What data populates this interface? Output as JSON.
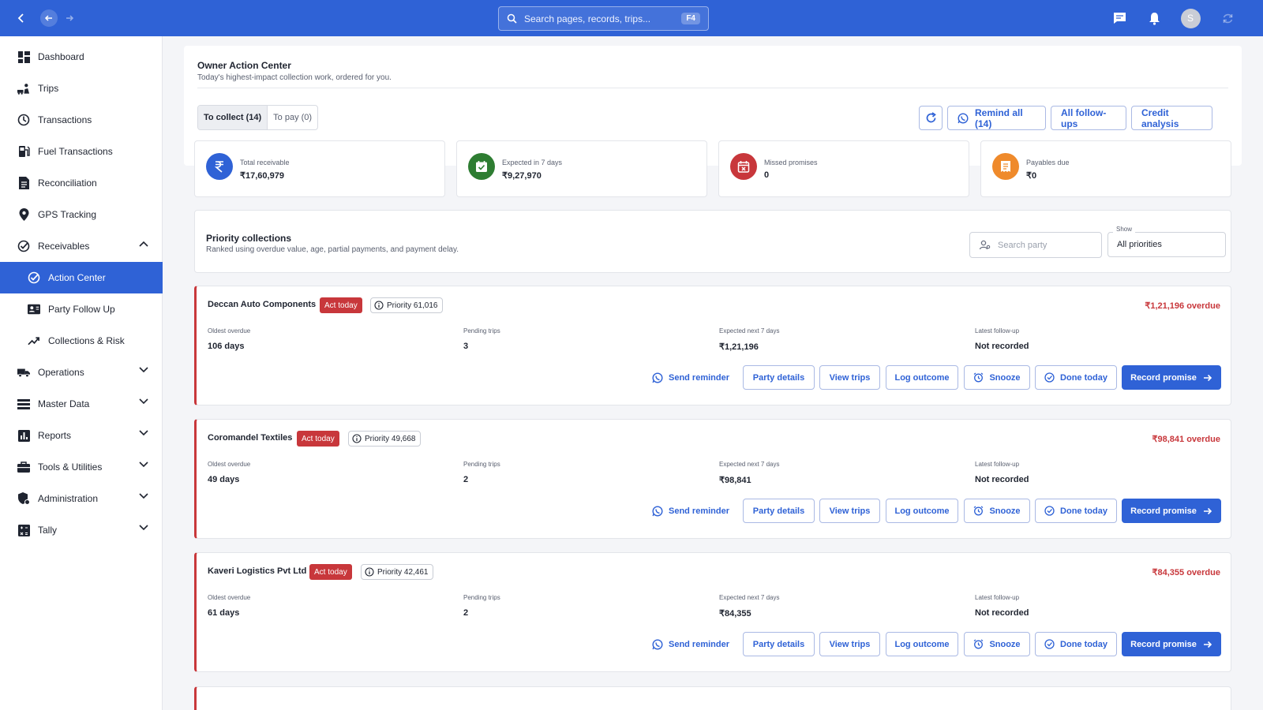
{
  "topbar": {
    "search_placeholder": "Search pages, records, trips...",
    "search_shortcut": "F4",
    "avatar_initial": "S",
    "icons": [
      "back-icon",
      "arrow-left-icon",
      "arrow-right-icon",
      "search-icon",
      "chat-icon",
      "bell-icon",
      "sync-icon"
    ]
  },
  "sidebar": {
    "items": [
      {
        "label": "Dashboard"
      },
      {
        "label": "Trips"
      },
      {
        "label": "Transactions"
      },
      {
        "label": "Fuel Transactions"
      },
      {
        "label": "Reconciliation"
      },
      {
        "label": "GPS Tracking"
      },
      {
        "label": "Receivables"
      },
      {
        "label": "Action Center"
      },
      {
        "label": "Party Follow Up"
      },
      {
        "label": "Collections & Risk"
      },
      {
        "label": "Operations"
      },
      {
        "label": "Master Data"
      },
      {
        "label": "Reports"
      },
      {
        "label": "Tools & Utilities"
      },
      {
        "label": "Administration"
      },
      {
        "label": "Tally"
      }
    ],
    "active_item": "Action Center"
  },
  "header": {
    "title": "Owner Action Center",
    "subtitle": "Today's highest-impact collection work, ordered for you.",
    "tabs": [
      {
        "label": "To collect (14)",
        "active": true
      },
      {
        "label": "To pay (0)",
        "active": false
      }
    ],
    "remind_all_label": "Remind all (14)",
    "all_followups_label": "All follow-ups",
    "credit_analysis_label": "Credit analysis"
  },
  "kpis": [
    {
      "label": "Total receivable",
      "value": "₹17,60,979",
      "color": "#2f62d6",
      "icon": "rupee-icon"
    },
    {
      "label": "Expected in 7 days",
      "value": "₹9,27,970",
      "color": "#2e7d32",
      "icon": "calendar-check-icon"
    },
    {
      "label": "Missed promises",
      "value": "0",
      "color": "#c8373b",
      "icon": "calendar-x-icon"
    },
    {
      "label": "Payables due",
      "value": "₹0",
      "color": "#ef8a2b",
      "icon": "receipt-icon"
    }
  ],
  "priority": {
    "title": "Priority collections",
    "subtitle": "Ranked using overdue value, age, partial payments, and payment delay.",
    "search_placeholder": "Search party",
    "show_label": "Show",
    "show_value": "All priorities"
  },
  "labels": {
    "oldest_overdue": "Oldest overdue",
    "pending_trips": "Pending trips",
    "expected_next": "Expected next 7 days",
    "latest_followup": "Latest follow-up"
  },
  "actions": {
    "send_reminder": "Send reminder",
    "party_details": "Party details",
    "view_trips": "View trips",
    "log_outcome": "Log outcome",
    "snooze": "Snooze",
    "done_today": "Done today",
    "record_promise": "Record promise"
  },
  "parties": [
    {
      "name": "Deccan Auto Components",
      "badge": "Act today",
      "priority": "Priority 61,016",
      "overdue": "₹1,21,196 overdue",
      "oldest": "106 days",
      "pending": "3",
      "expected": "₹1,21,196",
      "followup": "Not recorded"
    },
    {
      "name": "Coromandel Textiles",
      "badge": "Act today",
      "priority": "Priority 49,668",
      "overdue": "₹98,841 overdue",
      "oldest": "49 days",
      "pending": "2",
      "expected": "₹98,841",
      "followup": "Not recorded"
    },
    {
      "name": "Kaveri Logistics Pvt Ltd",
      "badge": "Act today",
      "priority": "Priority 42,461",
      "overdue": "₹84,355 overdue",
      "oldest": "61 days",
      "pending": "2",
      "expected": "₹84,355",
      "followup": "Not recorded"
    }
  ],
  "colors": {
    "primary": "#2f62d6",
    "danger": "#c8373b",
    "success": "#2e7d32",
    "warning": "#ef8a2b"
  }
}
